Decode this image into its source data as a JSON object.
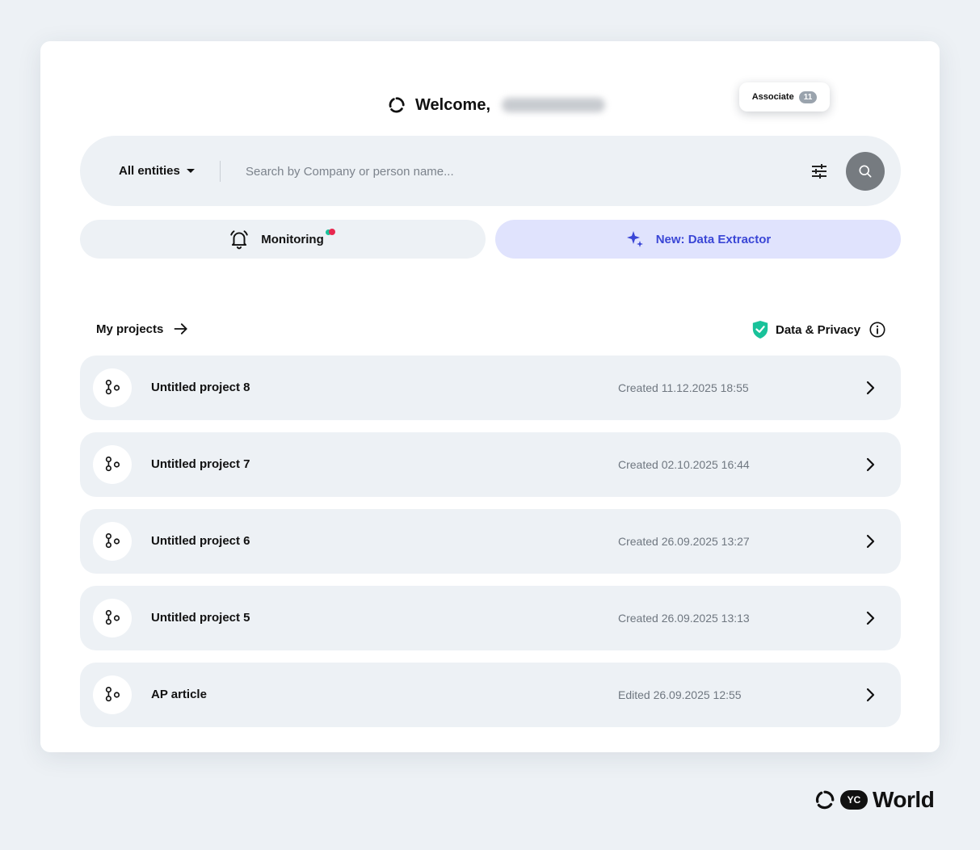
{
  "header": {
    "welcome_text": "Welcome,",
    "role_chip": {
      "label": "Associate",
      "count": "11"
    }
  },
  "search": {
    "scope_label": "All entities",
    "placeholder": "Search by Company or person name..."
  },
  "actions": {
    "monitoring_label": "Monitoring",
    "extractor_label": "New: Data Extractor"
  },
  "projects": {
    "heading": "My projects",
    "privacy_label": "Data & Privacy",
    "items": [
      {
        "name": "Untitled project 8",
        "date": "Created 11.12.2025 18:55"
      },
      {
        "name": "Untitled project 7",
        "date": "Created 02.10.2025 16:44"
      },
      {
        "name": "Untitled project 6",
        "date": "Created 26.09.2025 13:27"
      },
      {
        "name": "Untitled project 5",
        "date": "Created 26.09.2025 13:13"
      },
      {
        "name": "AP article",
        "date": "Edited 26.09.2025 12:55"
      }
    ]
  },
  "branding": {
    "badge": "YC",
    "wordmark": "World"
  },
  "colors": {
    "accent": "#3a46d6",
    "extractor_bg": "#e0e3fd",
    "privacy_shield": "#19c29a",
    "notification_red": "#e8284f",
    "panel_bg": "#edf1f5"
  }
}
